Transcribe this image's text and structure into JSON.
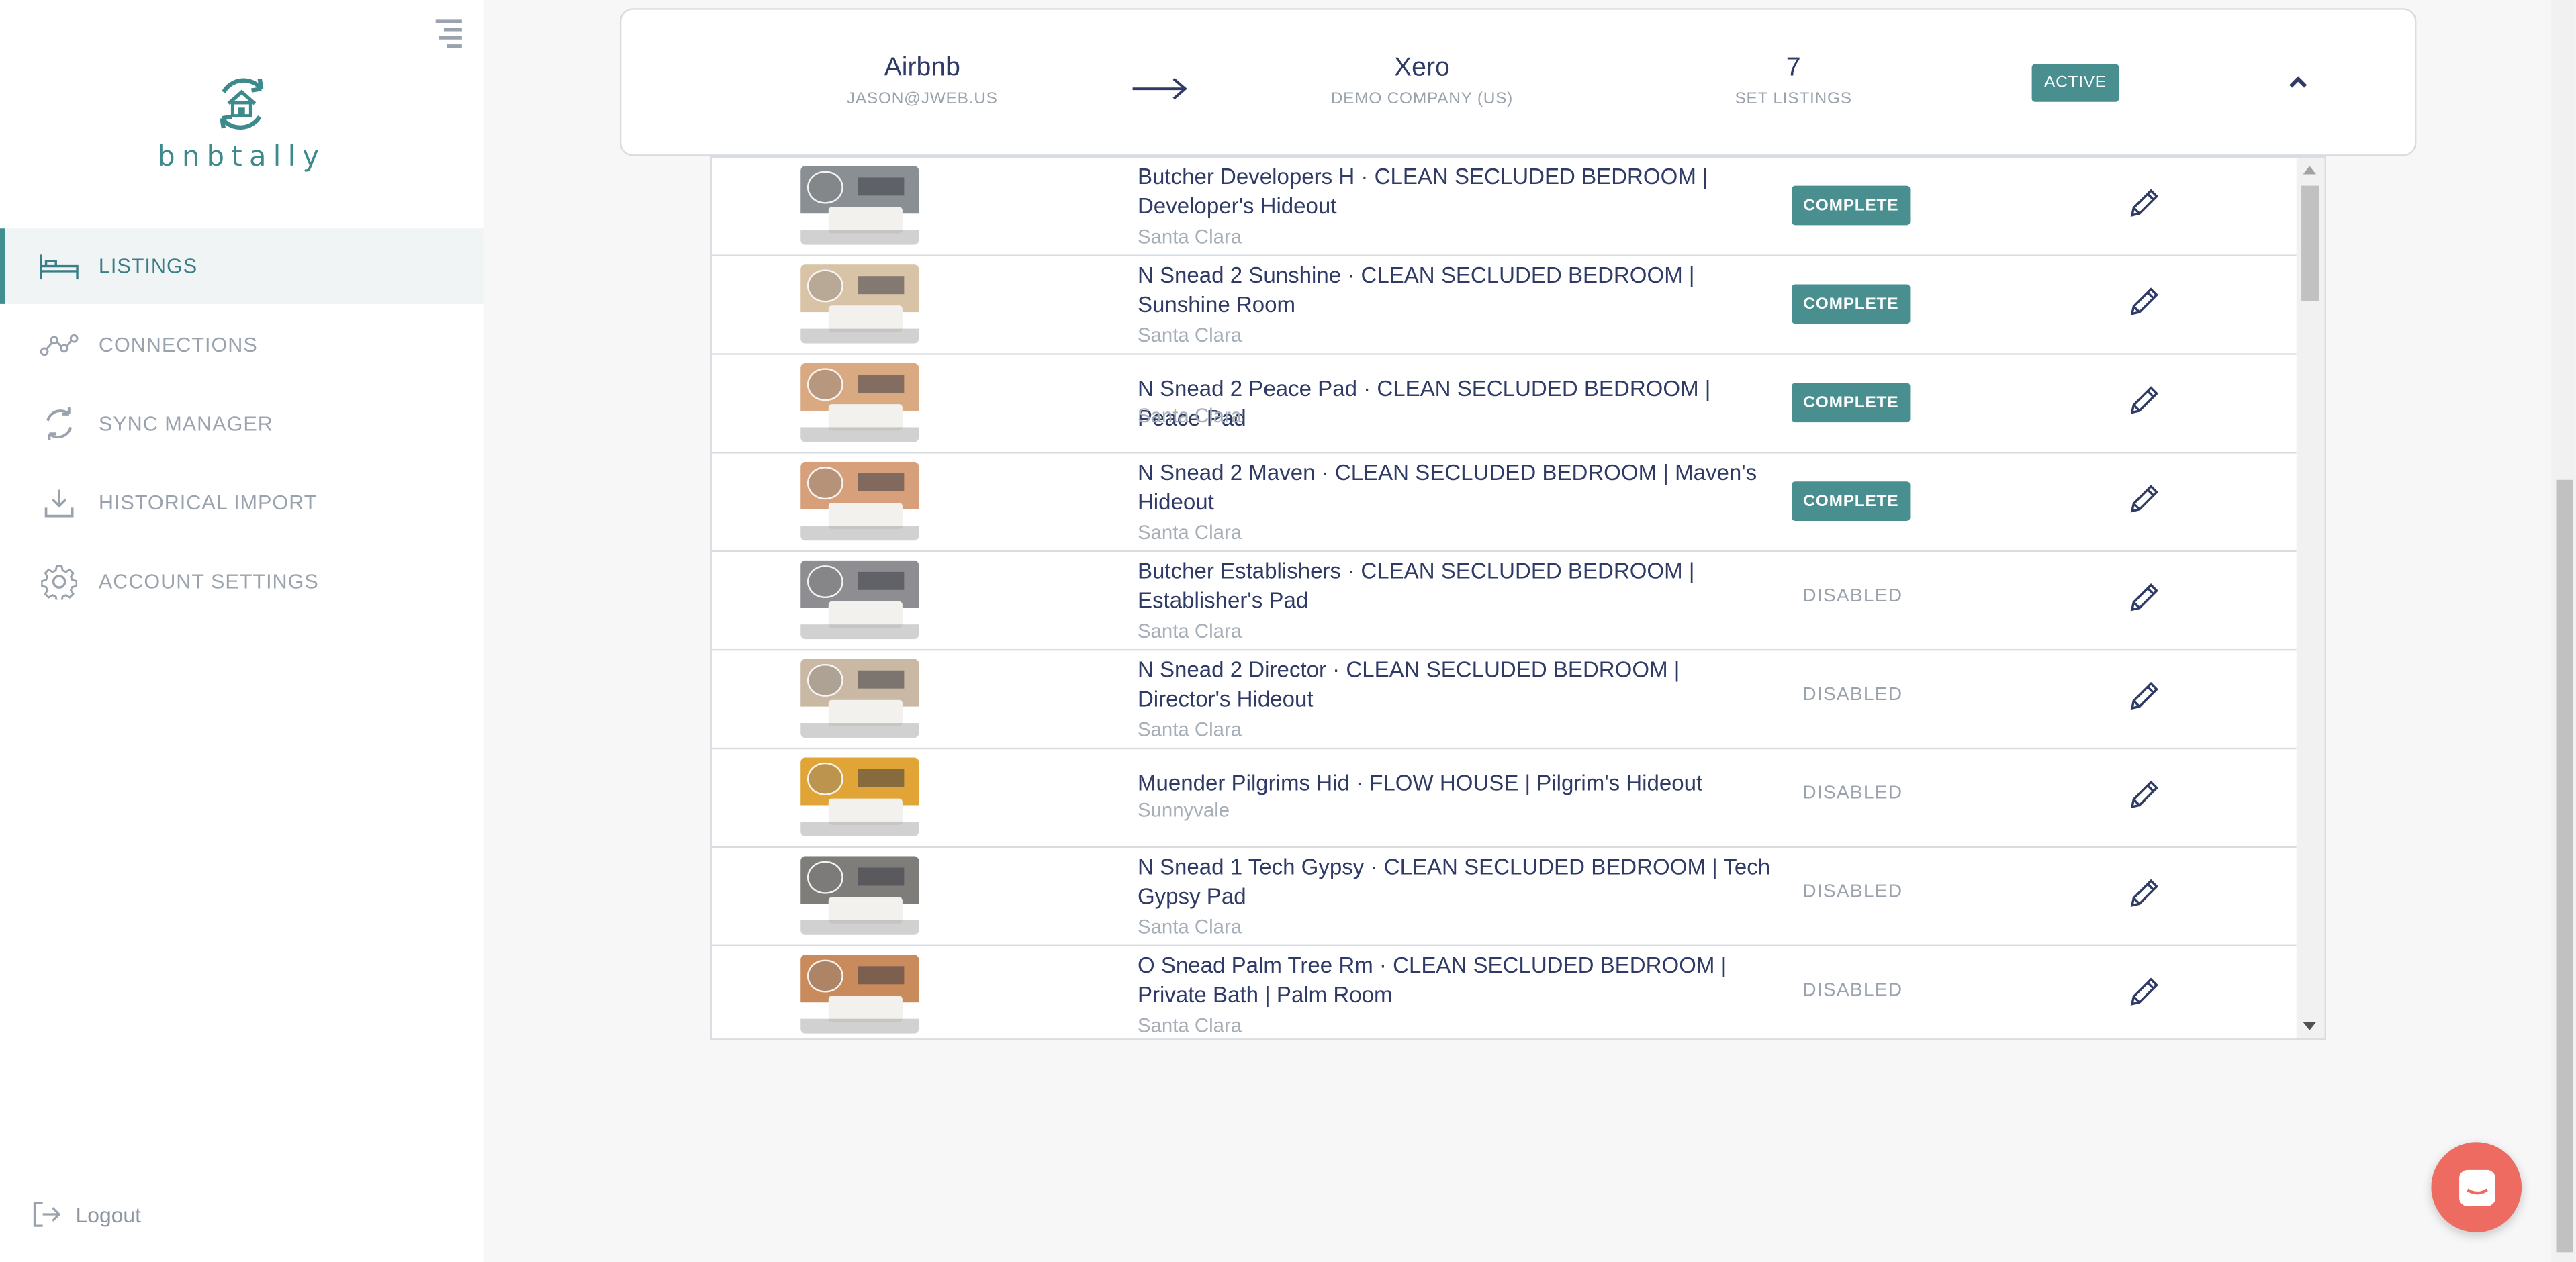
{
  "app": {
    "name": "bnbtally",
    "brand_color": "#3d8a8c",
    "accent": "#4a8f8f"
  },
  "sidebar": {
    "items": [
      {
        "label": "LISTINGS",
        "icon": "bed-icon",
        "active": true
      },
      {
        "label": "CONNECTIONS",
        "icon": "connections-icon",
        "active": false
      },
      {
        "label": "SYNC MANAGER",
        "icon": "sync-icon",
        "active": false
      },
      {
        "label": "HISTORICAL IMPORT",
        "icon": "download-icon",
        "active": false
      },
      {
        "label": "ACCOUNT SETTINGS",
        "icon": "gear-icon",
        "active": false
      }
    ],
    "logout_label": "Logout"
  },
  "connection": {
    "source_name": "Airbnb",
    "source_account": "JASON@JWEB.US",
    "target_name": "Xero",
    "target_account": "DEMO COMPANY (US)",
    "listings_count": "7",
    "listings_label": "SET LISTINGS",
    "status": "ACTIVE"
  },
  "listings": [
    {
      "title": "Butcher Developers H · CLEAN SECLUDED BEDROOM | Developer's Hideout",
      "location": "Santa Clara",
      "status": "COMPLETE",
      "wall": "#8a8f94"
    },
    {
      "title": "N Snead 2 Sunshine · CLEAN SECLUDED BEDROOM | Sunshine Room",
      "location": "Santa Clara",
      "status": "COMPLETE",
      "wall": "#d9c3a6"
    },
    {
      "title": "N Snead 2 Peace Pad · CLEAN SECLUDED BEDROOM | Peace Pad",
      "location": "Santa Clara",
      "status": "COMPLETE",
      "wall": "#d9a982"
    },
    {
      "title": "N Snead 2 Maven · CLEAN SECLUDED BEDROOM | Maven's Hideout",
      "location": "Santa Clara",
      "status": "COMPLETE",
      "wall": "#d8a07a"
    },
    {
      "title": "Butcher Establishers · CLEAN SECLUDED BEDROOM | Establisher's Pad",
      "location": "Santa Clara",
      "status": "DISABLED",
      "wall": "#8e8e92"
    },
    {
      "title": "N Snead 2 Director · CLEAN SECLUDED BEDROOM | Director's Hideout",
      "location": "Santa Clara",
      "status": "DISABLED",
      "wall": "#c9b8a3"
    },
    {
      "title": "Muender Pilgrims Hid · FLOW HOUSE | Pilgrim's Hideout",
      "location": "Sunnyvale",
      "status": "DISABLED",
      "wall": "#e0a437"
    },
    {
      "title": "N Snead 1 Tech Gypsy · CLEAN SECLUDED BEDROOM | Tech Gypsy Pad",
      "location": "Santa Clara",
      "status": "DISABLED",
      "wall": "#7f7d7a"
    },
    {
      "title": "O Snead Palm Tree Rm · CLEAN SECLUDED BEDROOM | Private Bath | Palm Room",
      "location": "Santa Clara",
      "status": "DISABLED",
      "wall": "#c98a5c"
    }
  ]
}
